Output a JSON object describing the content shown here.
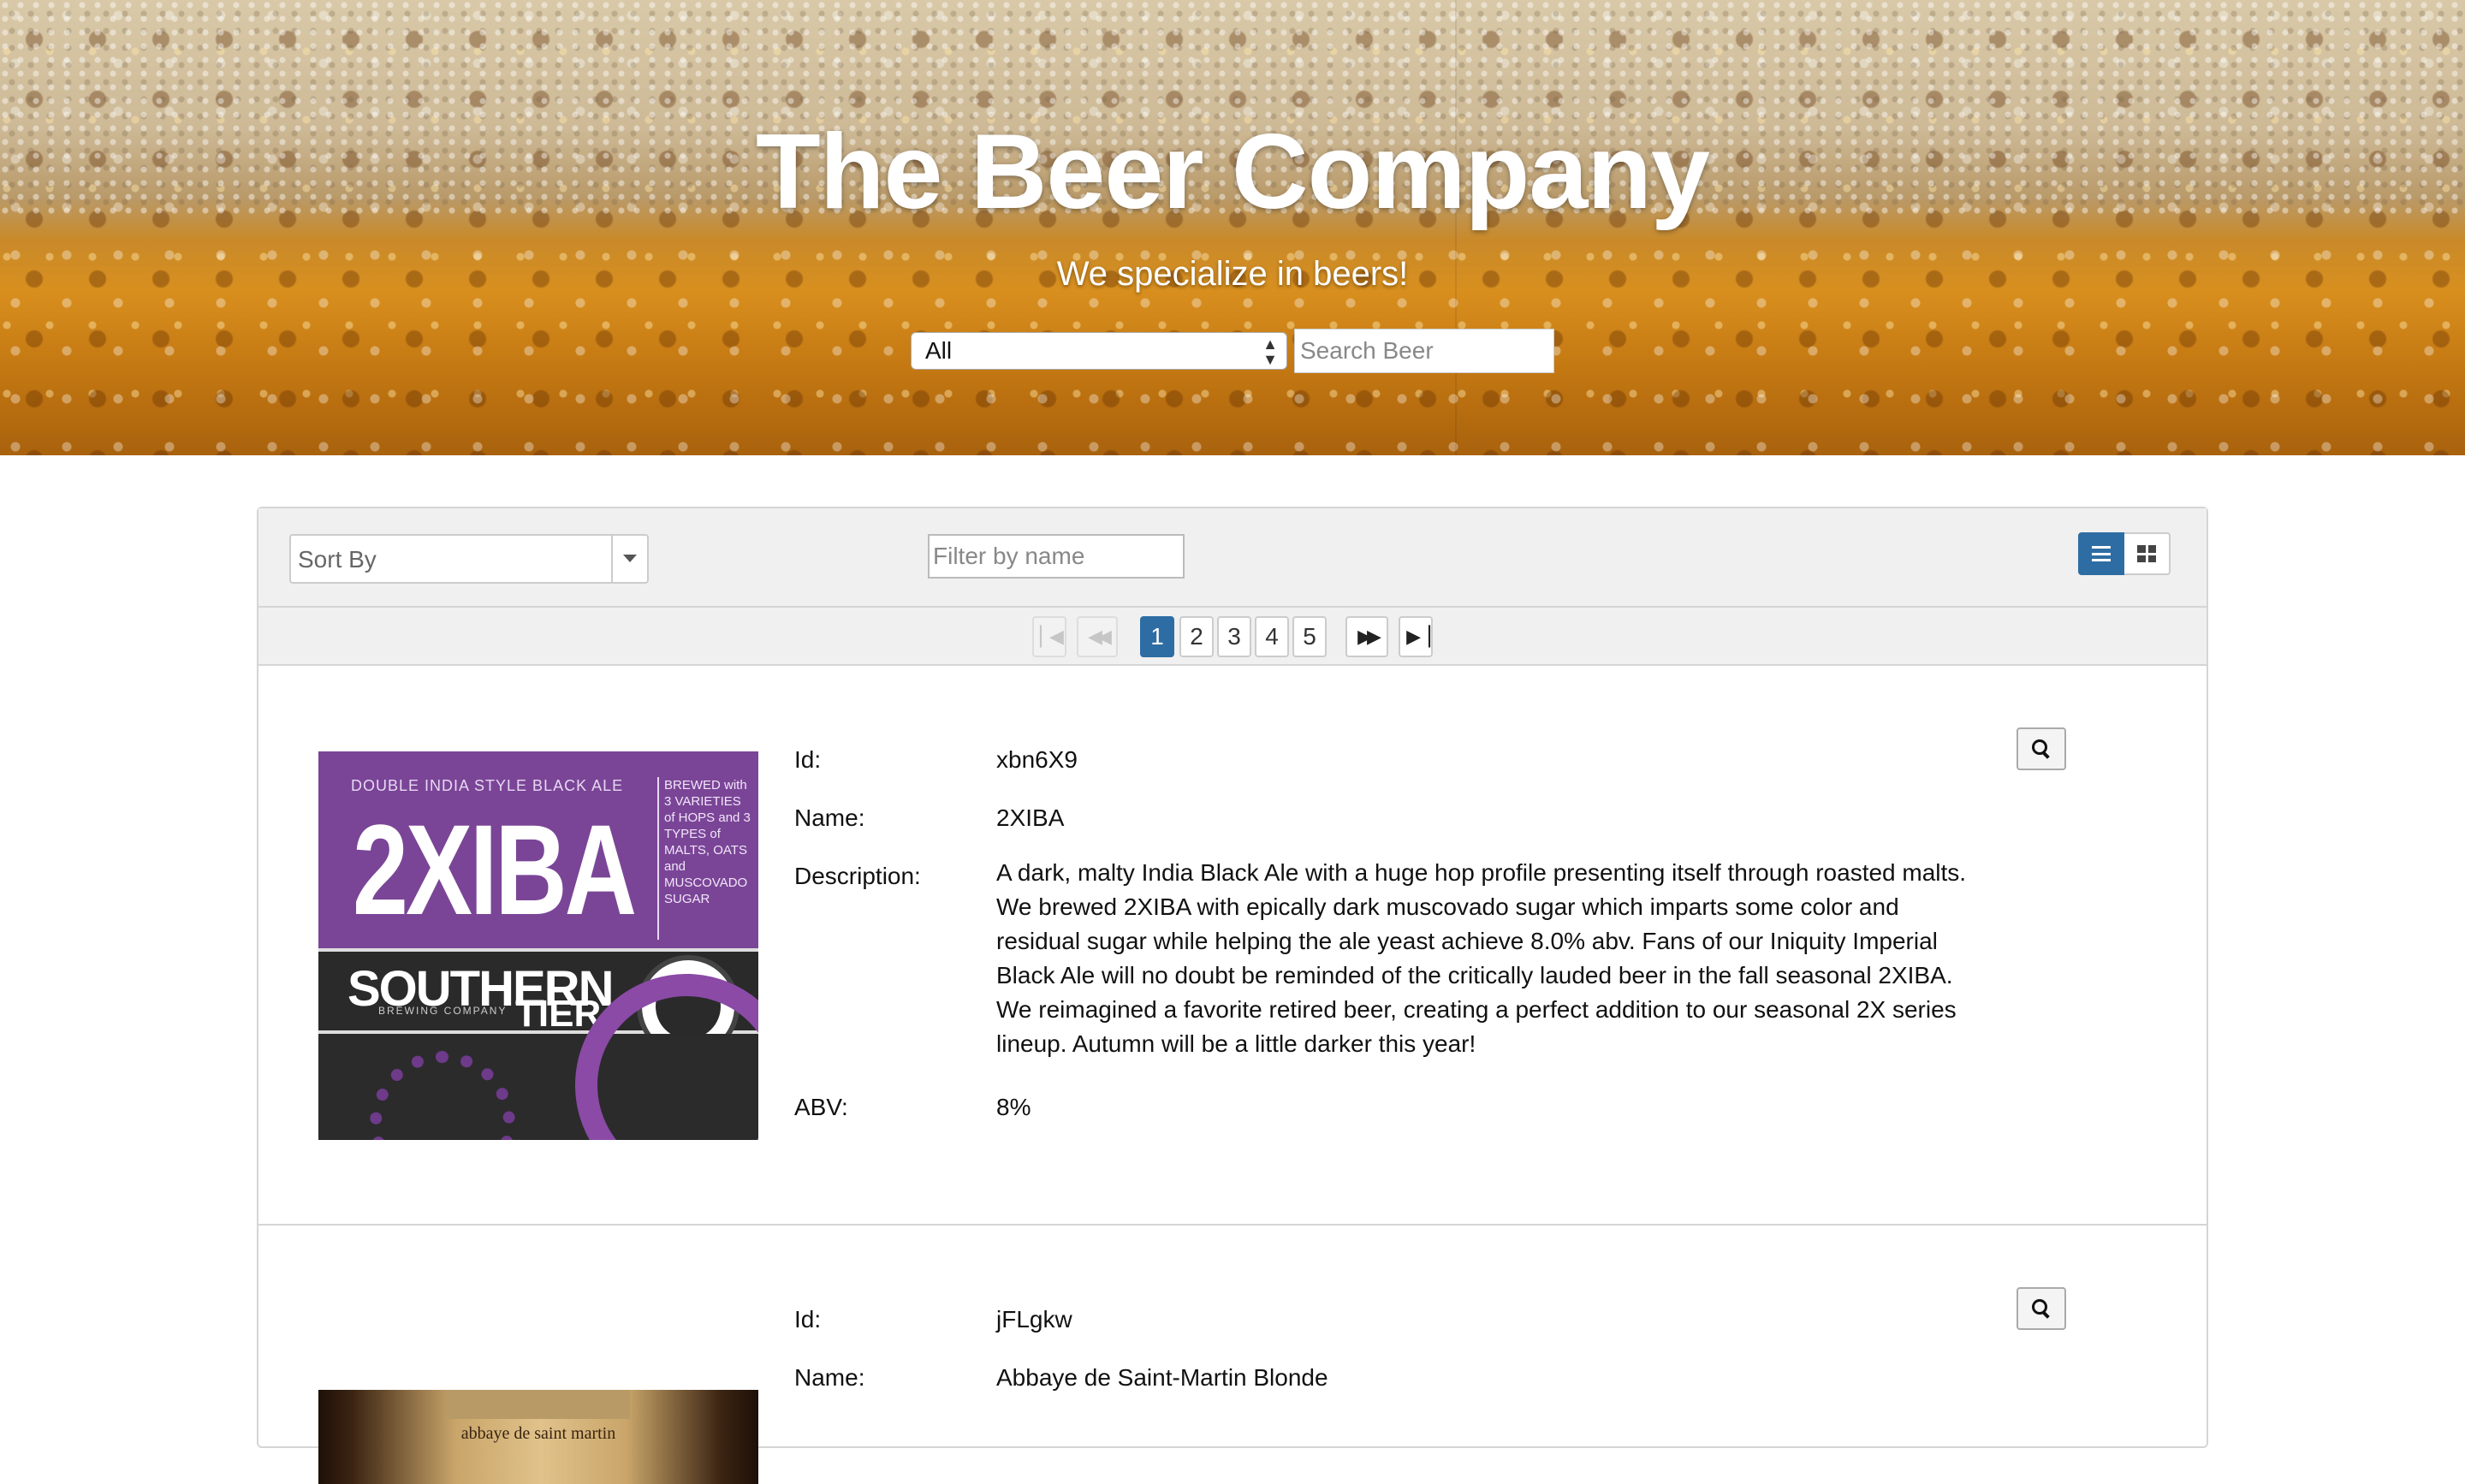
{
  "hero": {
    "title": "The Beer Company",
    "subtitle": "We specialize in beers!",
    "category_select": {
      "value": "All"
    },
    "search": {
      "placeholder": "Search Beer"
    }
  },
  "toolbar": {
    "sort": {
      "placeholder": "Sort By"
    },
    "filter": {
      "placeholder": "Filter by name"
    },
    "view_modes": [
      "list",
      "grid"
    ],
    "active_view": "list"
  },
  "pagination": {
    "pages": [
      "1",
      "2",
      "3",
      "4",
      "5"
    ],
    "current": "1"
  },
  "field_labels": {
    "id": "Id:",
    "name": "Name:",
    "description": "Description:",
    "abv": "ABV:"
  },
  "beers": [
    {
      "id": "xbn6X9",
      "name": "2XIBA",
      "description": "A dark, malty India Black Ale with a huge hop profile presenting itself through roasted malts. We brewed 2XIBA with epically dark muscovado sugar which imparts some color and residual sugar while helping the ale yeast achieve 8.0% abv. Fans of our Iniquity Imperial Black Ale will no doubt be reminded of the critically lauded beer in the fall seasonal 2XIBA. We reimagined a favorite retired beer, creating a perfect addition to our seasonal 2X series lineup. Autumn will be a little darker this year!",
      "abv": "8%",
      "label": {
        "tagline": "DOUBLE INDIA STYLE BLACK ALE",
        "name": "2XIBA",
        "side_text": "BREWED with 3 VARIETIES of HOPS and 3 TYPES of MALTS, OATS and MUSCOVADO SUGAR",
        "brand": "SOUTHERN",
        "brand_sub": "BREWING COMPANY",
        "brand2": "TIER"
      }
    },
    {
      "id": "jFLgkw",
      "name": "Abbaye de Saint-Martin Blonde",
      "label": {
        "text": "abbaye de saint martin"
      }
    }
  ],
  "colors": {
    "primary": "#2e6da4",
    "panel_bg": "#f0f0f0",
    "border": "#d5d5d5"
  }
}
